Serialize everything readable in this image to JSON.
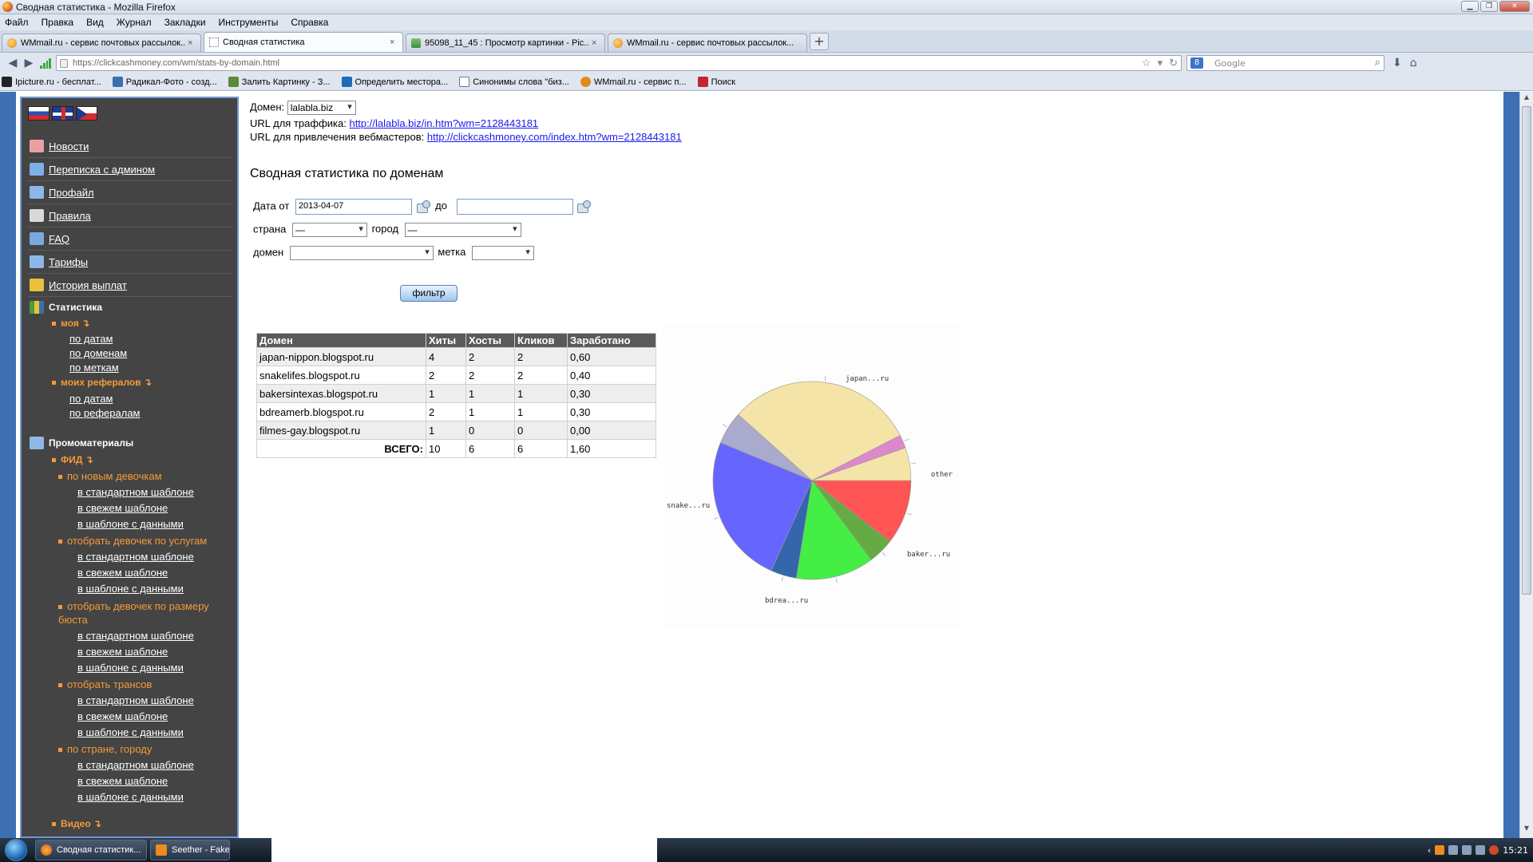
{
  "window": {
    "title": "Сводная статистика - Mozilla Firefox"
  },
  "menubar": [
    "Файл",
    "Правка",
    "Вид",
    "Журнал",
    "Закладки",
    "Инструменты",
    "Справка"
  ],
  "tabs": [
    {
      "label": "WMmail.ru - сервис почтовых рассылок...",
      "icon": "wmmail-icon",
      "active": false
    },
    {
      "label": "Сводная статистика",
      "icon": "blank-page-icon",
      "active": true
    },
    {
      "label": "95098_11_45 : Просмотр картинки - Pic...",
      "icon": "picture-icon",
      "active": false
    },
    {
      "label": "WMmail.ru - сервис почтовых рассылок...",
      "icon": "wmmail-icon",
      "active": false
    }
  ],
  "navbar": {
    "url": "https://clickcashmoney.com/wm/stats-by-domain.html",
    "search_placeholder": "Google"
  },
  "bookmarks": [
    {
      "label": "Ipicture.ru - бесплат...",
      "color": "#222222"
    },
    {
      "label": "Радикал-Фото - созд...",
      "color": "#3a6fb0"
    },
    {
      "label": "Залить Картинку - З...",
      "color": "#5a8a3a"
    },
    {
      "label": "Определить местора...",
      "color": "#1f6bb5"
    },
    {
      "label": "Синонимы слова \"биз...",
      "color": "#ffffff"
    },
    {
      "label": "WMmail.ru - сервис п...",
      "color": "#e08a1c"
    },
    {
      "label": "Поиск",
      "color": "#c0262e"
    }
  ],
  "sidebar": {
    "languages": [
      "ru",
      "en",
      "cz"
    ],
    "menu": [
      {
        "label": "Новости",
        "icon": "news-icon",
        "color": "#e8a0a0"
      },
      {
        "label": "Переписка с админом",
        "icon": "mail-icon",
        "color": "#7eb0e8"
      },
      {
        "label": "Профайл",
        "icon": "tools-icon",
        "color": "#8fb7e6"
      },
      {
        "label": "Правила",
        "icon": "book-icon",
        "color": "#d9d9d9"
      },
      {
        "label": "FAQ",
        "icon": "faq-icon",
        "color": "#7aa9e0"
      },
      {
        "label": "Тарифы",
        "icon": "tools-icon",
        "color": "#8fb7e6"
      },
      {
        "label": "История выплат",
        "icon": "hourglass-icon",
        "color": "#e8c23a"
      }
    ],
    "stats_title": "Статистика",
    "stats": {
      "mine": "моя ↴",
      "mine_links": [
        "по датам",
        "по доменам",
        "по меткам"
      ],
      "refs": "моих рефералов ↴",
      "refs_links": [
        "по датам",
        "по рефералам"
      ]
    },
    "promo_title": "Промоматериалы",
    "promo": {
      "feed": "ФИД ↴",
      "groups": [
        {
          "label": "по новым девочкам",
          "links": [
            "в стандартном шаблоне",
            "в свежем шаблоне",
            "в шаблоне с данными"
          ]
        },
        {
          "label": "отобрать девочек по услугам",
          "links": [
            "в стандартном шаблоне",
            "в свежем шаблоне",
            "в шаблоне с данными"
          ]
        },
        {
          "label": "отобрать девочек по размеру бюста",
          "links": [
            "в стандартном шаблоне",
            "в свежем шаблоне",
            "в шаблоне с данными"
          ]
        },
        {
          "label": "отобрать трансов",
          "links": [
            "в стандартном шаблоне",
            "в свежем шаблоне",
            "в шаблоне с данными"
          ]
        },
        {
          "label": "по стране, городу",
          "links": [
            "в стандартном шаблоне",
            "в свежем шаблоне",
            "в шаблоне с данными"
          ]
        }
      ],
      "video": "Видео ↴"
    }
  },
  "main": {
    "domain_label": "Домен:",
    "domain_value": "lalabla.biz",
    "traffic_url_label": "URL для траффика:",
    "traffic_url": "http://lalabla.biz/in.htm?wm=2128443181",
    "webmaster_url_label": "URL для привлечения вебмастеров:",
    "webmaster_url": "http://clickcashmoney.com/index.htm?wm=2128443181",
    "heading": "Сводная статистика по доменам",
    "filter": {
      "date_from_label": "Дата от",
      "date_from": "2013-04-07",
      "date_to_label": "до",
      "date_to": "",
      "country_label": "страна",
      "country_value": "—",
      "city_label": "город",
      "city_value": "—",
      "domain_label": "домен",
      "domain_value": "",
      "tag_label": "метка",
      "tag_value": "",
      "button": "фильтр"
    },
    "table": {
      "headers": [
        "Домен",
        "Хиты",
        "Хосты",
        "Кликов",
        "Заработано"
      ],
      "rows": [
        [
          "japan-nippon.blogspot.ru",
          "4",
          "2",
          "2",
          "0,60"
        ],
        [
          "snakelifes.blogspot.ru",
          "2",
          "2",
          "2",
          "0,40"
        ],
        [
          "bakersintexas.blogspot.ru",
          "1",
          "1",
          "1",
          "0,30"
        ],
        [
          "bdreamerb.blogspot.ru",
          "2",
          "1",
          "1",
          "0,30"
        ],
        [
          "filmes-gay.blogspot.ru",
          "1",
          "0",
          "0",
          "0,00"
        ]
      ],
      "total_label": "ВСЕГО:",
      "total": [
        "10",
        "6",
        "6",
        "1,60"
      ]
    }
  },
  "chart_data": {
    "type": "pie",
    "labels": [
      "other",
      "baker...ru",
      "bdrea...ru",
      "snake...ru",
      "japan...ru"
    ],
    "slices": [
      {
        "label": "other",
        "value": 8.3,
        "color": "#ff5555"
      },
      {
        "label": "baker...ru",
        "value": 3.3,
        "color": "#66aa44"
      },
      {
        "label": "bdrea...ru",
        "value": 10.0,
        "color": "#44ee44"
      },
      {
        "label": "",
        "value": 3.3,
        "color": "#3366aa"
      },
      {
        "label": "snake...ru",
        "value": 19.2,
        "color": "#6666ff"
      },
      {
        "label": "",
        "value": 4.2,
        "color": "#aaaacc"
      },
      {
        "label": "",
        "value": 24.2,
        "color": "#f5e4a8"
      },
      {
        "label": "japan...ru",
        "value": 1.7,
        "color": "#dd88cc"
      },
      {
        "label": "",
        "value": 4.2,
        "color": "#f5e4a8"
      }
    ]
  },
  "taskbar": {
    "tasks": [
      "Сводная статистик...",
      "Seether - Fake It"
    ],
    "time": "15:21"
  }
}
